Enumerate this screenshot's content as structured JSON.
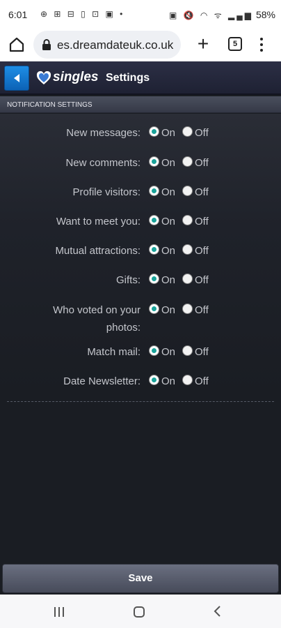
{
  "status_bar": {
    "time": "6:01",
    "left_icons": "⊕ ⊞ ⊟ ▯ ⊡ ▣ •",
    "right_icons": "▣ 🔇 ◠ ᯤ ▂▄▆",
    "battery": "58%"
  },
  "browser": {
    "url": "es.dreamdateuk.co.uk",
    "tab_count": "5",
    "plus_label": "+"
  },
  "app_header": {
    "logo_text": "singles",
    "title": "Settings"
  },
  "section": {
    "title": "NOTIFICATION SETTINGS"
  },
  "settings": [
    {
      "label": "New messages:",
      "on_label": "On",
      "off_label": "Off",
      "selected": "On"
    },
    {
      "label": "New comments:",
      "on_label": "On",
      "off_label": "Off",
      "selected": "On"
    },
    {
      "label": "Profile visitors:",
      "on_label": "On",
      "off_label": "Off",
      "selected": "On"
    },
    {
      "label": "Want to meet you:",
      "on_label": "On",
      "off_label": "Off",
      "selected": "On"
    },
    {
      "label": "Mutual attractions:",
      "on_label": "On",
      "off_label": "Off",
      "selected": "On"
    },
    {
      "label": "Gifts:",
      "on_label": "On",
      "off_label": "Off",
      "selected": "On"
    },
    {
      "label": "Who voted on your photos:",
      "on_label": "On",
      "off_label": "Off",
      "selected": "On"
    },
    {
      "label": "Match mail:",
      "on_label": "On",
      "off_label": "Off",
      "selected": "On"
    },
    {
      "label": "Date Newsletter:",
      "on_label": "On",
      "off_label": "Off",
      "selected": "On"
    }
  ],
  "save_button": "Save",
  "colors": {
    "accent_blue": "#1a84e0",
    "radio_selected": "#1aa39a"
  }
}
